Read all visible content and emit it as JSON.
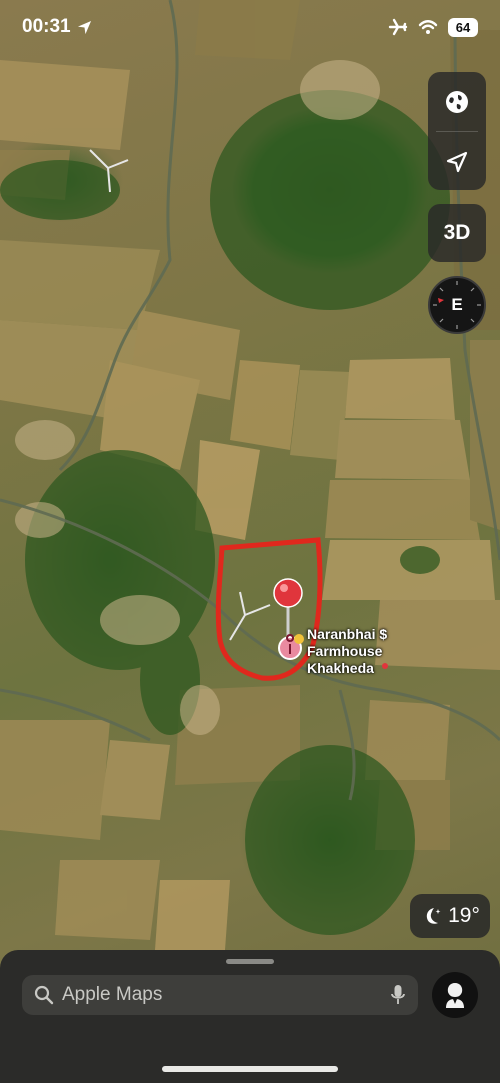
{
  "status_bar": {
    "time": "00:31",
    "battery": "64"
  },
  "map": {
    "controls": {
      "globe_icon": "globe-icon",
      "location_icon": "location-arrow-icon",
      "three_d_label": "3D",
      "compass_heading": "E"
    },
    "pin": {
      "label_lines": [
        "Naranbhai $",
        "Farmhouse",
        "Khakheda"
      ]
    },
    "weather": {
      "icon": "moon-stars-icon",
      "temperature": "19°"
    }
  },
  "search": {
    "placeholder": "Apple Maps",
    "search_icon": "search-icon",
    "mic_icon": "microphone-icon"
  },
  "colors": {
    "pin_red": "#e0353c",
    "boundary_red": "#e0281d",
    "control_bg": "#282828",
    "sheet_bg": "#2b2b29"
  }
}
